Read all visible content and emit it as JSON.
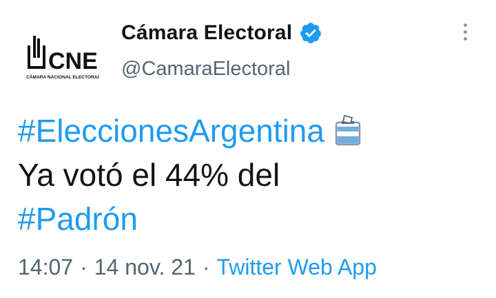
{
  "author": {
    "display_name": "Cámara Electoral",
    "handle": "@CamaraElectoral",
    "verified": true,
    "avatar": {
      "logo_text": "CNE",
      "logo_subtext": "CÁMARA NACIONAL ELECTORAL",
      "icon": "cne-ballot-box-logo-icon"
    }
  },
  "tweet": {
    "hashtag_1": "#EleccionesArgentina",
    "emoji": "ballot-box-icon",
    "text": "Ya votó el 44% del",
    "hashtag_2": "#Padrón"
  },
  "meta": {
    "time": "14:07",
    "separator": "·",
    "date": "14 nov. 21",
    "source": "Twitter Web App"
  },
  "colors": {
    "accent": "#1d9bf0",
    "text": "#0f1419",
    "muted": "#536471"
  },
  "icons": {
    "verified": "verified-badge-icon",
    "more": "more-options-icon"
  }
}
